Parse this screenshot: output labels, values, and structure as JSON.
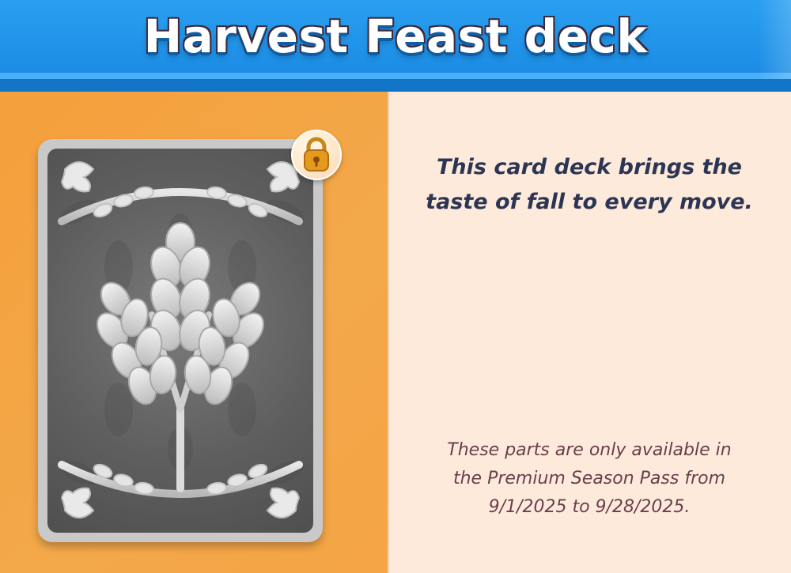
{
  "header": {
    "title": "Harvest Feast deck"
  },
  "card": {
    "locked": true,
    "icons": [
      "wheat-icon",
      "leaf-icon",
      "lock-icon"
    ]
  },
  "info": {
    "description": "This card deck brings the\ntaste of fall to every move.",
    "availability": "These parts are only available in\nthe Premium Season Pass from\n9/1/2025 to 9/28/2025."
  },
  "colors": {
    "header_blue": "#1d8fe6",
    "left_panel_orange": "#f4a03b",
    "right_panel_cream": "#fdeadb",
    "description_text": "#2c3654",
    "availability_text": "#6a3e4d",
    "lock_gold": "#e39a1d"
  }
}
